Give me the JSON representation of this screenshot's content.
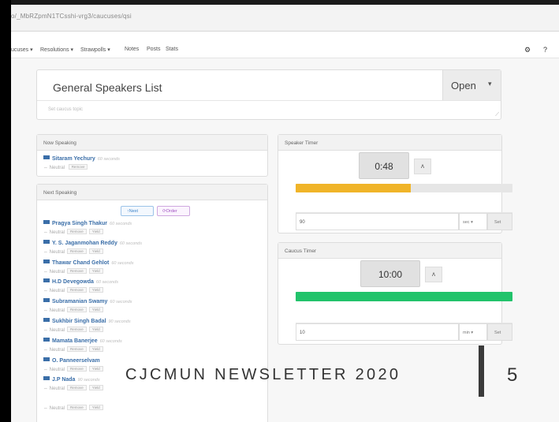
{
  "browser": {
    "url": "o/_MbRZpmN1TCsshi-vrg3/caucuses/qsi"
  },
  "nav": {
    "items": [
      "ucuses ▾",
      "Resolutions ▾",
      "Strawpolls ▾",
      "Notes",
      "Posts",
      "Stats"
    ],
    "right_icons": [
      "settings-icon",
      "help-icon"
    ],
    "settings_glyph": "⚙",
    "help_glyph": "?"
  },
  "header": {
    "title": "General Speakers List",
    "status_label": "Open",
    "caret": "▾",
    "subtitle": "Set caucus topic",
    "grip": "⟋"
  },
  "now_speaking": {
    "label": "Now Speaking",
    "speaker": {
      "name": "Sitaram Yechury",
      "duration": "60 seconds",
      "stance": "Neutral",
      "actions": [
        "Remove"
      ]
    }
  },
  "next_speaking": {
    "label": "Next Speaking",
    "next_button": "↑Next",
    "order_button": "⟳Order",
    "speakers": [
      {
        "name": "Pragya Singh Thakur",
        "duration": "60 seconds",
        "stance": "Neutral",
        "actions": [
          "Remove",
          "Yield"
        ]
      },
      {
        "name": "Y. S. Jaganmohan Reddy",
        "duration": "60 seconds",
        "stance": "Neutral",
        "actions": [
          "Remove",
          "Yield"
        ]
      },
      {
        "name": "Thawar Chand Gehlot",
        "duration": "60 seconds",
        "stance": "Neutral",
        "actions": [
          "Remove",
          "Yield"
        ]
      },
      {
        "name": "H.D Devegowda",
        "duration": "60 seconds",
        "stance": "Neutral",
        "actions": [
          "Remove",
          "Yield"
        ]
      },
      {
        "name": "Subramanian Swamy",
        "duration": "60 seconds",
        "stance": "Neutral",
        "actions": [
          "Remove",
          "Yield"
        ]
      },
      {
        "name": "Sukhbir Singh Badal",
        "duration": "90 seconds",
        "stance": "Neutral",
        "actions": [
          "Remove",
          "Yield"
        ]
      },
      {
        "name": "Mamata Banerjee",
        "duration": "60 seconds",
        "stance": "Neutral",
        "actions": [
          "Remove",
          "Yield"
        ]
      },
      {
        "name": "O. Panneerselvam",
        "duration": "",
        "stance": "Neutral",
        "actions": [
          "Remove",
          "Yield"
        ]
      },
      {
        "name": "J.P Nada",
        "duration": "90 seconds",
        "stance": "Neutral",
        "actions": [
          "Remove",
          "Yield"
        ]
      },
      {
        "name": "",
        "duration": "",
        "stance": "Neutral",
        "actions": [
          "Remove",
          "Yield"
        ]
      }
    ]
  },
  "speaker_timer": {
    "label": "Speaker Timer",
    "time": "0:48",
    "toggle_label": "ʌ",
    "progress": 0.53,
    "bar_color": "#f0b429",
    "input_value": "90",
    "unit": "sec ▾",
    "set_label": "Set"
  },
  "caucus_timer": {
    "label": "Caucus Timer",
    "time": "10:00",
    "toggle_label": "ʌ",
    "progress": 1.0,
    "bar_color": "#22c36b",
    "input_value": "10",
    "unit": "min ▾",
    "set_label": "Set"
  },
  "overlay": {
    "newsletter": "CJCMUN NEWSLETTER 2020",
    "page": "5"
  },
  "icons": {
    "flag": "flag-icon",
    "stance": "thumb-icon",
    "stance_glyph": "⇔"
  }
}
